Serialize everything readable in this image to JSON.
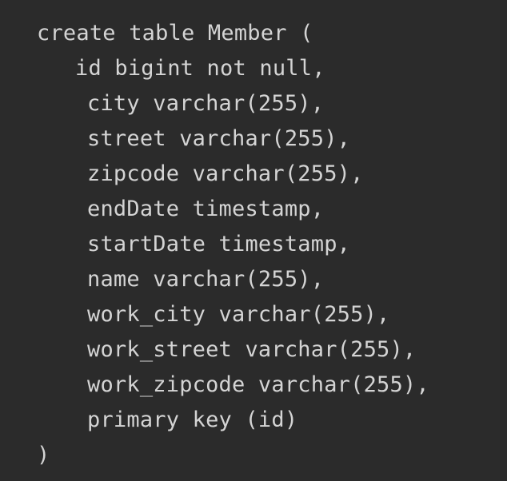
{
  "editor": {
    "lines": [
      "create table Member (",
      "id bigint not null,",
      "city varchar(255),",
      "street varchar(255),",
      "zipcode varchar(255),",
      "endDate timestamp,",
      "startDate timestamp,",
      "name varchar(255),",
      "work_city varchar(255),",
      "work_street varchar(255),",
      "work_zipcode varchar(255),",
      "primary key (id)",
      ")"
    ]
  },
  "colors": {
    "background": "#2b2b2b",
    "text": "#d4d4d4"
  }
}
